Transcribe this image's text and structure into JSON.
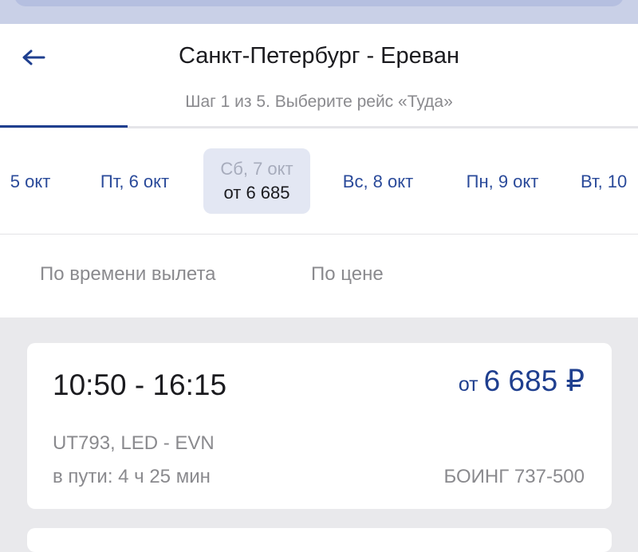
{
  "header": {
    "title": "Санкт-Петербург - Ереван",
    "step": "Шаг 1 из 5. Выберите рейс «Туда»",
    "back_icon": "arrow-left-icon",
    "progress": 0.2
  },
  "dates": [
    {
      "label": "5 окт",
      "price": ""
    },
    {
      "label": "Пт, 6 окт",
      "price": ""
    },
    {
      "label": "Сб, 7 окт",
      "price": "от 6 685",
      "selected": true
    },
    {
      "label": "Вс, 8 окт",
      "price": ""
    },
    {
      "label": "Пн, 9 окт",
      "price": ""
    },
    {
      "label": "Вт, 10",
      "price": ""
    }
  ],
  "sort": {
    "by_time": "По времени вылета",
    "by_price": "По цене"
  },
  "flight": {
    "time": "10:50 - 16:15",
    "price_prefix": "от",
    "price": "6 685 ₽",
    "code": "UT793, LED - EVN",
    "duration": "в пути: 4 ч 25 мин",
    "aircraft": "БОИНГ 737-500"
  },
  "colors": {
    "accent": "#1f3f8f",
    "date_text": "#2a4a9a",
    "muted": "#8a8a8e",
    "background": "#e9e9ec",
    "selected_bg": "#e3e7f3"
  }
}
